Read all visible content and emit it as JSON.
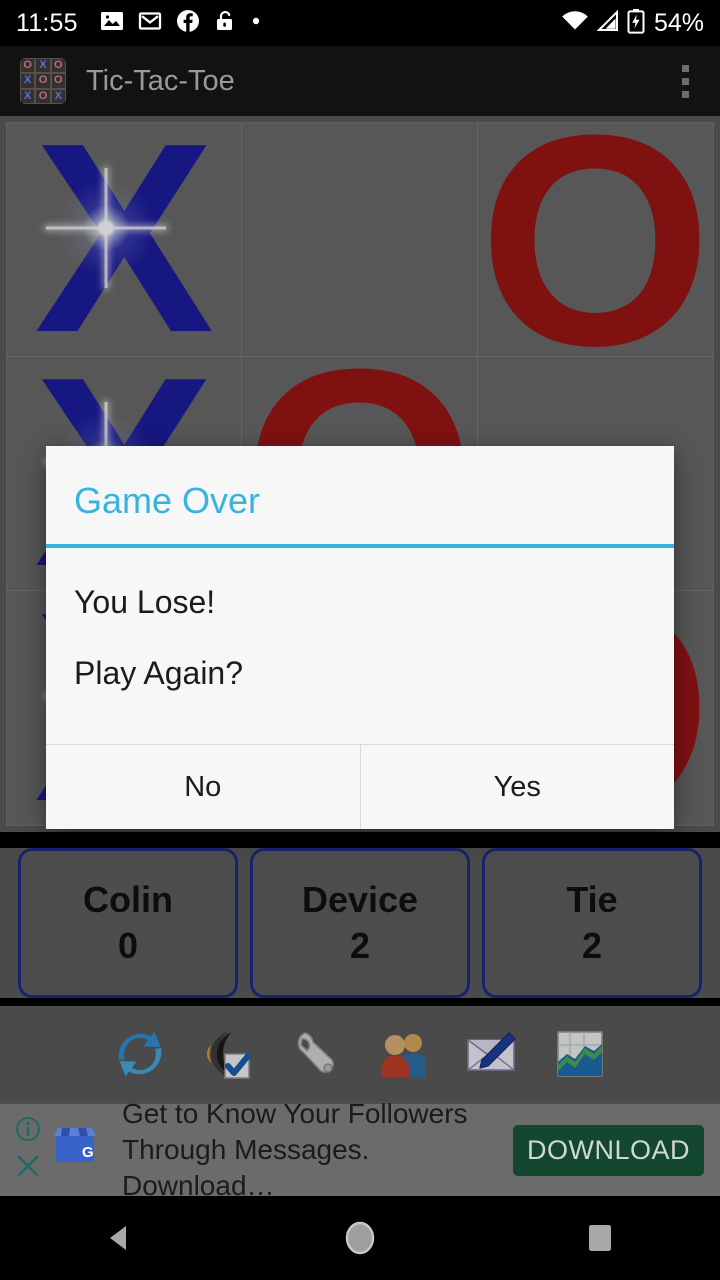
{
  "status_bar": {
    "clock": "11:55",
    "battery_percent": "54%",
    "left_icons": [
      "image-icon",
      "gmail-icon",
      "facebook-icon",
      "unlock-icon",
      "dot-icon"
    ],
    "right_icons": [
      "wifi-icon",
      "cell-signal-icon",
      "battery-charging-icon"
    ]
  },
  "app_bar": {
    "title": "Tic-Tac-Toe",
    "app_icon": "tic-tac-toe-app-icon",
    "app_icon_grid": [
      "O",
      "X",
      "O",
      "X",
      "O",
      "O",
      "X",
      "O",
      "X"
    ],
    "overflow_icon": "overflow-menu-icon"
  },
  "board": {
    "cells": [
      {
        "mark": "X",
        "winning": true
      },
      {
        "mark": "",
        "winning": false
      },
      {
        "mark": "O",
        "winning": false
      },
      {
        "mark": "X",
        "winning": true
      },
      {
        "mark": "O",
        "winning": false
      },
      {
        "mark": "",
        "winning": false
      },
      {
        "mark": "X",
        "winning": true
      },
      {
        "mark": "",
        "winning": false
      },
      {
        "mark": "O",
        "winning": false
      }
    ],
    "colors": {
      "x": "#1d1d9e",
      "o": "#9c1515",
      "background": "#6b6b6b"
    }
  },
  "dialog": {
    "title": "Game Over",
    "message_line_1": "You Lose!",
    "message_line_2": "Play Again?",
    "button_no": "No",
    "button_yes": "Yes",
    "accent_color": "#39b3dd"
  },
  "scores": [
    {
      "name": "Colin",
      "value": "0"
    },
    {
      "name": "Device",
      "value": "2"
    },
    {
      "name": "Tie",
      "value": "2"
    }
  ],
  "toolbar_icons": [
    "refresh-new-game-icon",
    "sound-settings-icon",
    "wrench-settings-icon",
    "players-icon",
    "message-compose-icon",
    "statistics-chart-icon"
  ],
  "ad": {
    "info_icon": "ad-info-icon",
    "close_icon": "ad-close-icon",
    "advertiser_icon": "google-my-business-icon",
    "line_1": "Get to Know Your Followers",
    "line_2": "Through Messages. Download…",
    "cta_label": "DOWNLOAD",
    "cta_color": "#14472f"
  },
  "nav_bar": {
    "back": "back-nav-icon",
    "home": "home-nav-icon",
    "recents": "recents-nav-icon"
  }
}
